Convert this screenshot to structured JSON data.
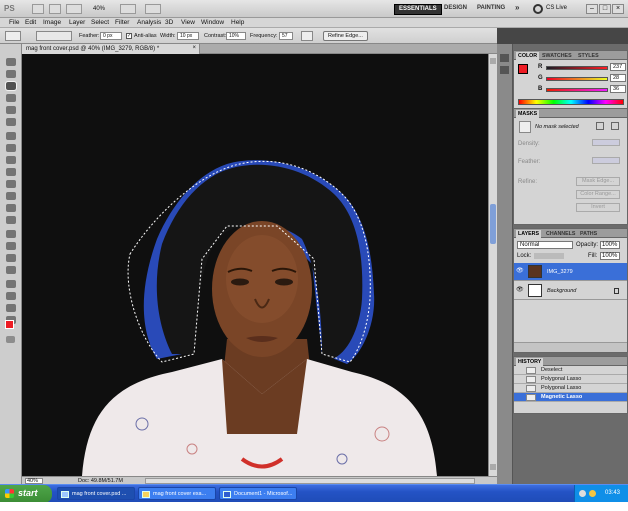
{
  "appbar": {
    "logo": "PS",
    "zoom": "40%",
    "workspaces": [
      "ESSENTIALS",
      "DESIGN",
      "PAINTING"
    ],
    "more": "»",
    "cslive": "CS Live",
    "win_min": "–",
    "win_max": "□",
    "win_close": "×"
  },
  "menu": [
    "File",
    "Edit",
    "Image",
    "Layer",
    "Select",
    "Filter",
    "Analysis",
    "3D",
    "View",
    "Window",
    "Help"
  ],
  "options": {
    "feather_label": "Feather:",
    "feather_value": "0 px",
    "antialias_label": "Anti-alias",
    "width_label": "Width:",
    "width_value": "10 px",
    "contrast_label": "Contrast:",
    "contrast_value": "10%",
    "frequency_label": "Frequency:",
    "frequency_value": "57",
    "refine_label": "Refine Edge..."
  },
  "document": {
    "tab_title": "mag front cover.psd @ 40% (IMG_3279, RGB/8) *",
    "close": "×",
    "zoom_status": "40%",
    "doc_status": "Doc: 49.8M/51.7M"
  },
  "color_panel": {
    "tabs": [
      "COLOR",
      "SWATCHES",
      "STYLES"
    ],
    "r_label": "R",
    "r_value": "237",
    "g_label": "G",
    "g_value": "28",
    "b_label": "B",
    "b_value": "36",
    "foreground": "#ed1c24",
    "background": "#000000"
  },
  "masks_panel": {
    "title": "MASKS",
    "status": "No mask selected",
    "density_label": "Density:",
    "feather_label": "Feather:",
    "refine_label": "Refine:",
    "mask_edge": "Mask Edge...",
    "color_range": "Color Range...",
    "invert": "Invert"
  },
  "layers_panel": {
    "tabs": [
      "LAYERS",
      "CHANNELS",
      "PATHS"
    ],
    "blend_mode": "Normal",
    "opacity_label": "Opacity:",
    "opacity_value": "100%",
    "lock_label": "Lock:",
    "fill_label": "Fill:",
    "fill_value": "100%",
    "layers": [
      {
        "name": "IMG_3279",
        "selected": true
      },
      {
        "name": "Background",
        "selected": false
      }
    ]
  },
  "history_panel": {
    "title": "HISTORY",
    "items": [
      {
        "name": "Deselect",
        "selected": false
      },
      {
        "name": "Polygonal Lasso",
        "selected": false
      },
      {
        "name": "Polygonal Lasso",
        "selected": false
      },
      {
        "name": "Magnetic Lasso",
        "selected": true
      }
    ]
  },
  "taskbar": {
    "start": "start",
    "tasks": [
      "mag front cover.psd ...",
      "mag front cover exa...",
      "Document1 - Microsof..."
    ],
    "clock": "03:43"
  },
  "colors": {
    "selection_blue": "#3160e8",
    "taskbar_blue": "#2453c5",
    "layer_selected": "#3a6fd8"
  }
}
